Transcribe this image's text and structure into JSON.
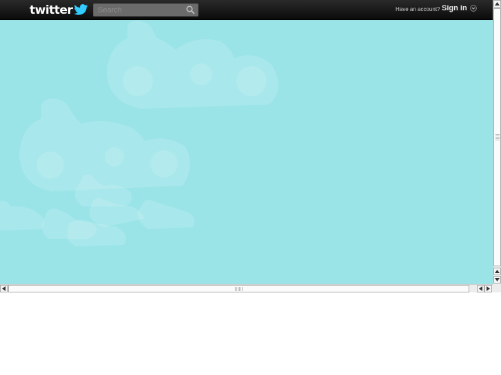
{
  "header": {
    "logo_text": "twitter",
    "search": {
      "placeholder": "Search",
      "value": ""
    },
    "account_prompt": "Have an account?",
    "signin_label": "Sign in"
  },
  "icons": {
    "logo_bird": "twitter-bird-icon",
    "search": "magnifier-icon",
    "signin_dropdown": "chevron-down-icon"
  },
  "colors": {
    "background": "#9ae4e8",
    "topbar": "#0b0b0b",
    "bird": "#33ccff"
  }
}
